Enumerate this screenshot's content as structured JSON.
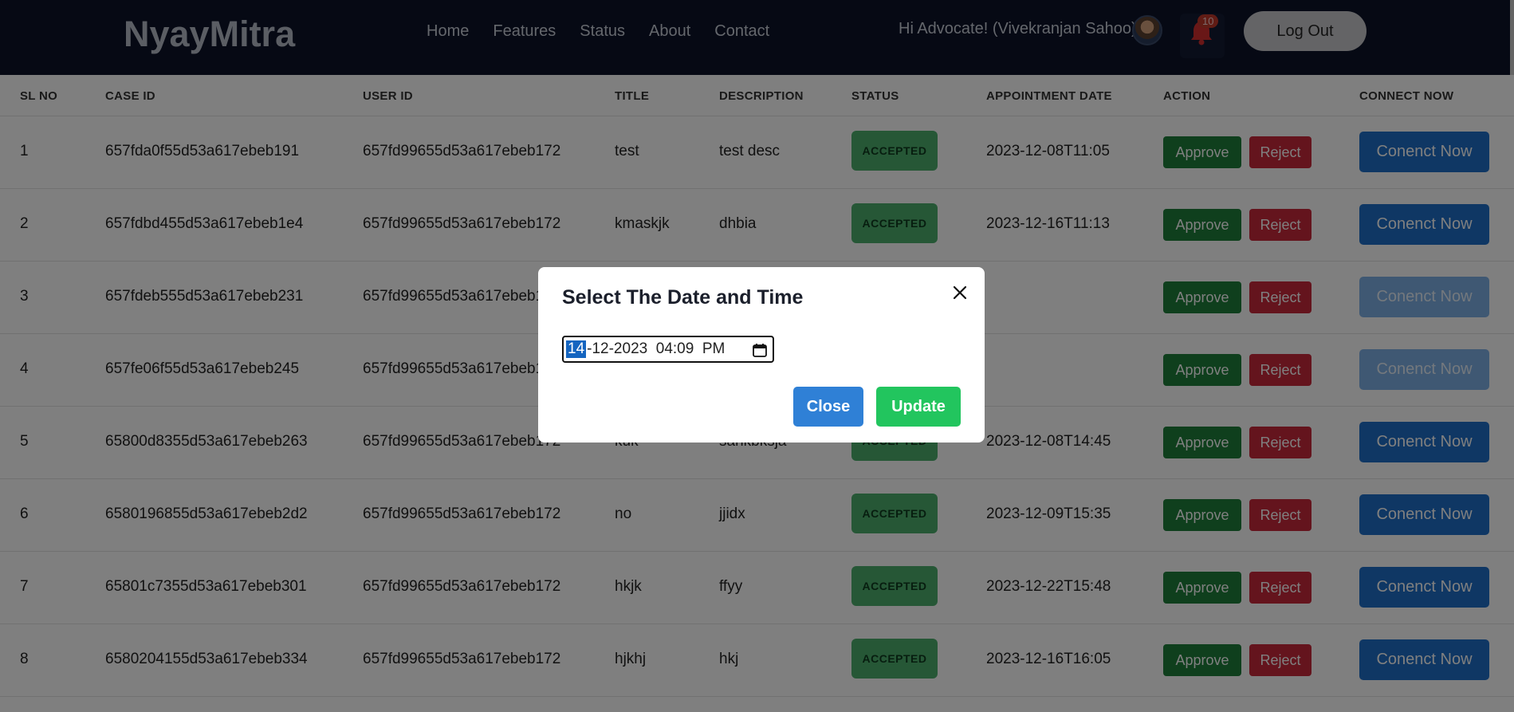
{
  "navbar": {
    "brand": "NyayMitra",
    "links": [
      "Home",
      "Features",
      "Status",
      "About",
      "Contact"
    ],
    "greeting": "Hi Advocate! (Vivekranjan Sahoo)",
    "notification_count": "10",
    "logout_label": "Log Out"
  },
  "table": {
    "headers": [
      "SL NO",
      "CASE ID",
      "USER ID",
      "TITLE",
      "DESCRIPTION",
      "STATUS",
      "APPOINTMENT DATE",
      "ACTION",
      "CONNECT NOW"
    ],
    "rows": [
      {
        "sl": "1",
        "case_id": "657fda0f55d53a617ebeb191",
        "user_id": "657fd99655d53a617ebeb172",
        "title": "test",
        "description": "test desc",
        "status": "ACCEPTED",
        "date": "2023-12-08T11:05",
        "connect_enabled": true
      },
      {
        "sl": "2",
        "case_id": "657fdbd455d53a617ebeb1e4",
        "user_id": "657fd99655d53a617ebeb172",
        "title": "kmaskjk",
        "description": "dhbia",
        "status": "ACCEPTED",
        "date": "2023-12-16T11:13",
        "connect_enabled": true
      },
      {
        "sl": "3",
        "case_id": "657fdeb555d53a617ebeb231",
        "user_id": "657fd99655d53a617ebeb172",
        "title": "",
        "description": "",
        "status": "",
        "date": "",
        "connect_enabled": false
      },
      {
        "sl": "4",
        "case_id": "657fe06f55d53a617ebeb245",
        "user_id": "657fd99655d53a617ebeb172",
        "title": "",
        "description": "",
        "status": "",
        "date": "",
        "connect_enabled": false
      },
      {
        "sl": "5",
        "case_id": "65800d8355d53a617ebeb263",
        "user_id": "657fd99655d53a617ebeb172",
        "title": "kuk",
        "description": "sahkbksja",
        "status": "ACCEPTED",
        "date": "2023-12-08T14:45",
        "connect_enabled": true
      },
      {
        "sl": "6",
        "case_id": "6580196855d53a617ebeb2d2",
        "user_id": "657fd99655d53a617ebeb172",
        "title": "no",
        "description": "jjidx",
        "status": "ACCEPTED",
        "date": "2023-12-09T15:35",
        "connect_enabled": true
      },
      {
        "sl": "7",
        "case_id": "65801c7355d53a617ebeb301",
        "user_id": "657fd99655d53a617ebeb172",
        "title": "hkjk",
        "description": "ffyy",
        "status": "ACCEPTED",
        "date": "2023-12-22T15:48",
        "connect_enabled": true
      },
      {
        "sl": "8",
        "case_id": "6580204155d53a617ebeb334",
        "user_id": "657fd99655d53a617ebeb172",
        "title": "hjkhj",
        "description": "hkj",
        "status": "ACCEPTED",
        "date": "2023-12-16T16:05",
        "connect_enabled": true
      }
    ],
    "approve_label": "Approve",
    "reject_label": "Reject",
    "connect_label": "Conenct Now"
  },
  "modal": {
    "title": "Select The Date and Time",
    "datetime_day": "14",
    "datetime_rest": "-12-2023  04:09  PM",
    "close_label": "Close",
    "update_label": "Update"
  },
  "colors": {
    "navbar_bg": "#0d1329",
    "approve": "#1e7e3a",
    "reject": "#c8283a",
    "connect": "#1f6fc9",
    "update": "#22c55e",
    "status_accepted": "#4caf6d"
  },
  "icons": {
    "close": "close-icon",
    "calendar": "calendar-icon",
    "bell": "bell-icon",
    "avatar": "user-avatar"
  }
}
